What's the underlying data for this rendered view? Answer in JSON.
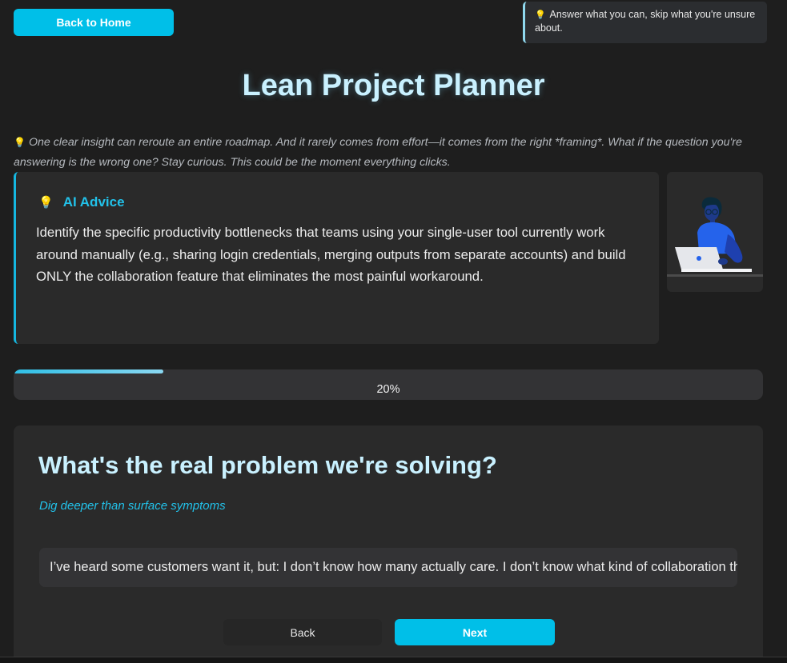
{
  "nav": {
    "back_home_label": "Back to Home"
  },
  "tip": {
    "icon": "lightbulb-icon",
    "text": "Answer what you can, skip what you're unsure about."
  },
  "page_title": "Lean Project Planner",
  "insight_quote": "One clear insight can reroute an entire roadmap. And it rarely comes from effort—it comes from the right *framing*. What if the question you're answering is the wrong one? Stay curious. This could be the moment everything clicks.",
  "advice": {
    "heading": "AI Advice",
    "body": "Identify the specific productivity bottlenecks that teams using your single-user tool currently work around manually (e.g., sharing login credentials, merging outputs from separate accounts) and build ONLY the collaboration feature that eliminates the most painful workaround."
  },
  "illustration": "person-at-laptop-illustration",
  "progress": {
    "value": 0.2,
    "label": "20%"
  },
  "question": {
    "title": "What's the real problem we're solving?",
    "subtitle": "Dig deeper than surface symptoms",
    "answer_value": "I’ve heard some customers want it, but:  I don’t know how many actually care.  I don’t know what kind of collaboration they need."
  },
  "buttons": {
    "back_label": "Back",
    "next_label": "Next"
  },
  "colors": {
    "accent": "#00bfe8",
    "title": "#c9f1ff",
    "background": "#1e1e1e",
    "card": "#2a2a2a"
  }
}
